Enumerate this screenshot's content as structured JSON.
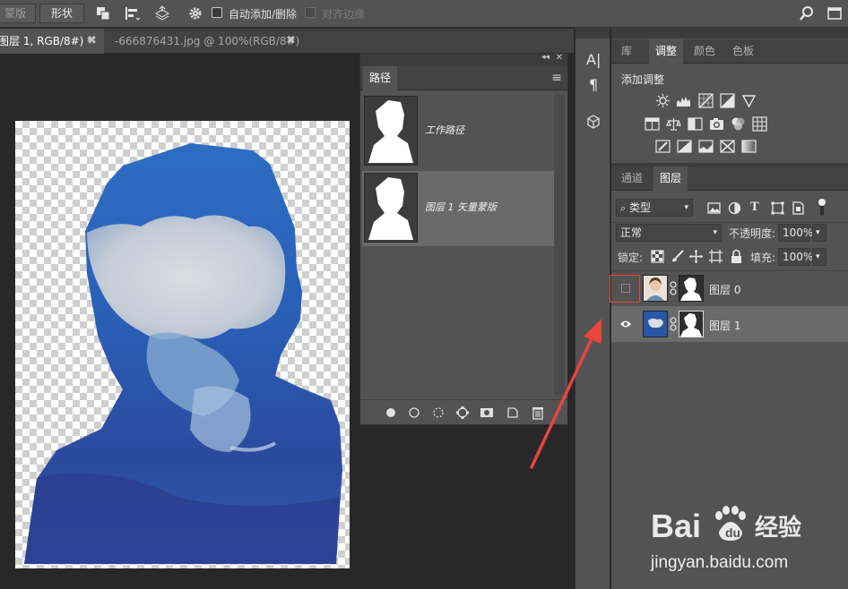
{
  "options_bar": {
    "mask_button": "蒙版",
    "shape_button": "形状",
    "auto_add_delete_label": "自动添加/删除",
    "align_edges_label": "对齐边缘"
  },
  "doc_tabs": [
    {
      "label": "图层 1, RGB/8#) *",
      "close": "✖"
    },
    {
      "label": "-666876431.jpg @ 100%(RGB/8#)",
      "close": "✖"
    }
  ],
  "paths_panel": {
    "tab": "路径",
    "collapse": "◂◂",
    "close": "✕",
    "menu": "≡",
    "items": [
      {
        "name": "工作路径"
      },
      {
        "name": "图层 1 矢量蒙版"
      }
    ]
  },
  "mini_toolbar": {
    "character_glyph": "A|",
    "paragraph_glyph": "¶"
  },
  "top_right_panel": {
    "tabs": [
      "库",
      "调整",
      "颜色",
      "色板"
    ],
    "active_tab": "调整",
    "heading": "添加调整"
  },
  "layers_panel": {
    "tabs": [
      "通道",
      "图层"
    ],
    "active_tab": "图层",
    "filter_kind": "类型",
    "blend_mode": "正常",
    "opacity_label": "不透明度:",
    "opacity_value": "100%",
    "lock_label": "锁定:",
    "fill_label": "填充:",
    "fill_value": "100%",
    "layers": [
      {
        "name": "图层 0",
        "visible": false
      },
      {
        "name": "图层 1",
        "visible": true
      }
    ]
  },
  "watermark": {
    "brand": "Bai 经验",
    "url": "jingyan.baidu.com"
  },
  "colors": {
    "accent_red": "#e8453c",
    "panel_bg": "#535353",
    "selected_row": "#6a6a6a"
  }
}
